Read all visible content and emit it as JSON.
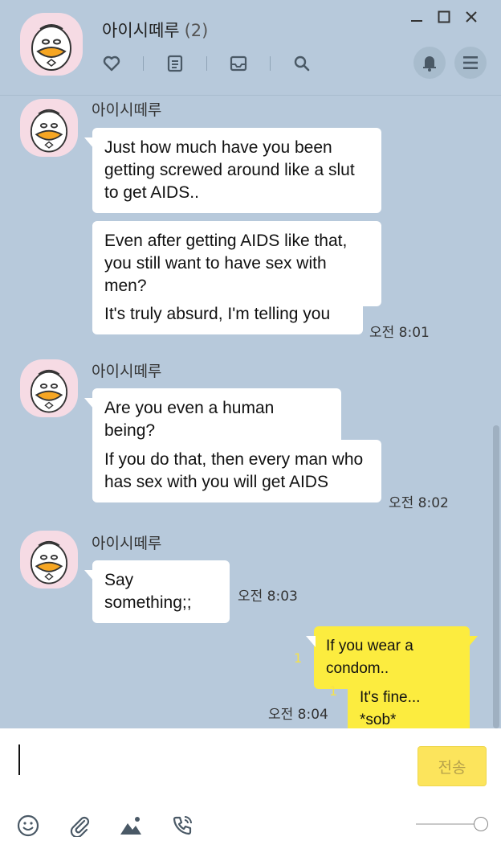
{
  "chat": {
    "title": "아이시떼루",
    "member_count": "(2)"
  },
  "sender_name": "아이시떼루",
  "groups": [
    {
      "sender": "아이시떼루",
      "messages": [
        "Just how much have you been getting screwed around like a slut to get AIDS..",
        "Even after getting AIDS like that, you still want to have sex with men?",
        "It's truly absurd, I'm telling you"
      ],
      "time": "오전 8:01"
    },
    {
      "sender": "아이시떼루",
      "messages": [
        "Are you even a human being?",
        "If you do that, then every man who has sex with you will get AIDS"
      ],
      "time": "오전 8:02"
    },
    {
      "sender": "아이시떼루",
      "messages": [
        "Say something;;"
      ],
      "time": "오전 8:03"
    }
  ],
  "mine": {
    "messages": [
      "If you wear a condom..",
      "It's fine... *sob*"
    ],
    "unread": [
      "1",
      "1"
    ],
    "time": "오전 8:04"
  },
  "composer": {
    "send_label": "전송"
  },
  "icons": {
    "header": [
      "heart-icon",
      "notes-icon",
      "inbox-icon",
      "search-icon"
    ],
    "window": [
      "minimize-icon",
      "maximize-icon",
      "close-icon"
    ],
    "right": [
      "bell-icon",
      "menu-icon"
    ],
    "tools": [
      "emoji-icon",
      "attachment-icon",
      "image-icon",
      "call-icon"
    ]
  },
  "colors": {
    "background": "#b7c9db",
    "my_bubble": "#fcec3f",
    "other_bubble": "#ffffff",
    "send_button": "#fce45c"
  }
}
